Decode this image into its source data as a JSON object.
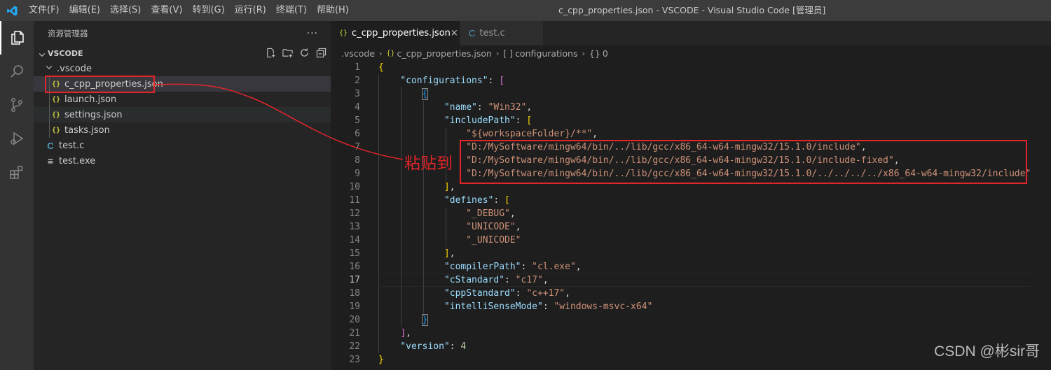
{
  "titlebar": {
    "menu": [
      "文件(F)",
      "编辑(E)",
      "选择(S)",
      "查看(V)",
      "转到(G)",
      "运行(R)",
      "终端(T)",
      "帮助(H)"
    ],
    "window_title": "c_cpp_properties.json - VSCODE - Visual Studio Code [管理员]"
  },
  "sidebar": {
    "title": "资源管理器",
    "more": "···",
    "section_title": "VSCODE",
    "tree": [
      {
        "label": ".vscode",
        "type": "folder"
      },
      {
        "label": "c_cpp_properties.json",
        "type": "json",
        "icon": "{}"
      },
      {
        "label": "launch.json",
        "type": "json",
        "icon": "{}"
      },
      {
        "label": "settings.json",
        "type": "json",
        "icon": "{}"
      },
      {
        "label": "tasks.json",
        "type": "json",
        "icon": "{}"
      },
      {
        "label": "test.c",
        "type": "c",
        "icon": "C"
      },
      {
        "label": "test.exe",
        "type": "exe",
        "icon": "≡"
      }
    ]
  },
  "tabs": [
    {
      "label": "c_cpp_properties.json",
      "icon": "{}",
      "close": "×"
    },
    {
      "label": "test.c",
      "icon": "C"
    }
  ],
  "breadcrumb": [
    ".vscode",
    "c_cpp_properties.json",
    "configurations",
    "0"
  ],
  "breadcrumb_icons": [
    "{}",
    "[ ]",
    "{}"
  ],
  "code": {
    "line_numbers": [
      "1",
      "2",
      "3",
      "4",
      "5",
      "6",
      "7",
      "8",
      "9",
      "10",
      "11",
      "12",
      "13",
      "14",
      "15",
      "16",
      "17",
      "18",
      "19",
      "20",
      "21",
      "22",
      "23"
    ],
    "current_line": "17",
    "strings": {
      "configurations": "\"configurations\"",
      "name": "\"name\"",
      "win32": "\"Win32\"",
      "includePath": "\"includePath\"",
      "ws": "\"${workspaceFolder}/**\"",
      "p1": "\"D:/MySoftware/mingw64/bin/../lib/gcc/x86_64-w64-mingw32/15.1.0/include\"",
      "p2": "\"D:/MySoftware/mingw64/bin/../lib/gcc/x86_64-w64-mingw32/15.1.0/include-fixed\"",
      "p3": "\"D:/MySoftware/mingw64/bin/../lib/gcc/x86_64-w64-mingw32/15.1.0/../../../../x86_64-w64-mingw32/include\"",
      "defines": "\"defines\"",
      "debug": "\"_DEBUG\"",
      "unicode": "\"UNICODE\"",
      "_unicode": "\"_UNICODE\"",
      "compilerPath": "\"compilerPath\"",
      "cl": "\"cl.exe\"",
      "cStandard": "\"cStandard\"",
      "c17": "\"c17\"",
      "cppStandard": "\"cppStandard\"",
      "cpp17": "\"c++17\"",
      "intelliSenseMode": "\"intelliSenseMode\"",
      "msvc": "\"windows-msvc-x64\"",
      "version": "\"version\"",
      "four": "4"
    }
  },
  "annotation": {
    "text": "粘贴到",
    "color": "#e0252b"
  },
  "watermark": "CSDN @彬sir哥",
  "colors": {
    "accent": "#007acc",
    "annotation": "#e0252b",
    "json_icon": "#cbcb41",
    "c_icon": "#519aba"
  }
}
